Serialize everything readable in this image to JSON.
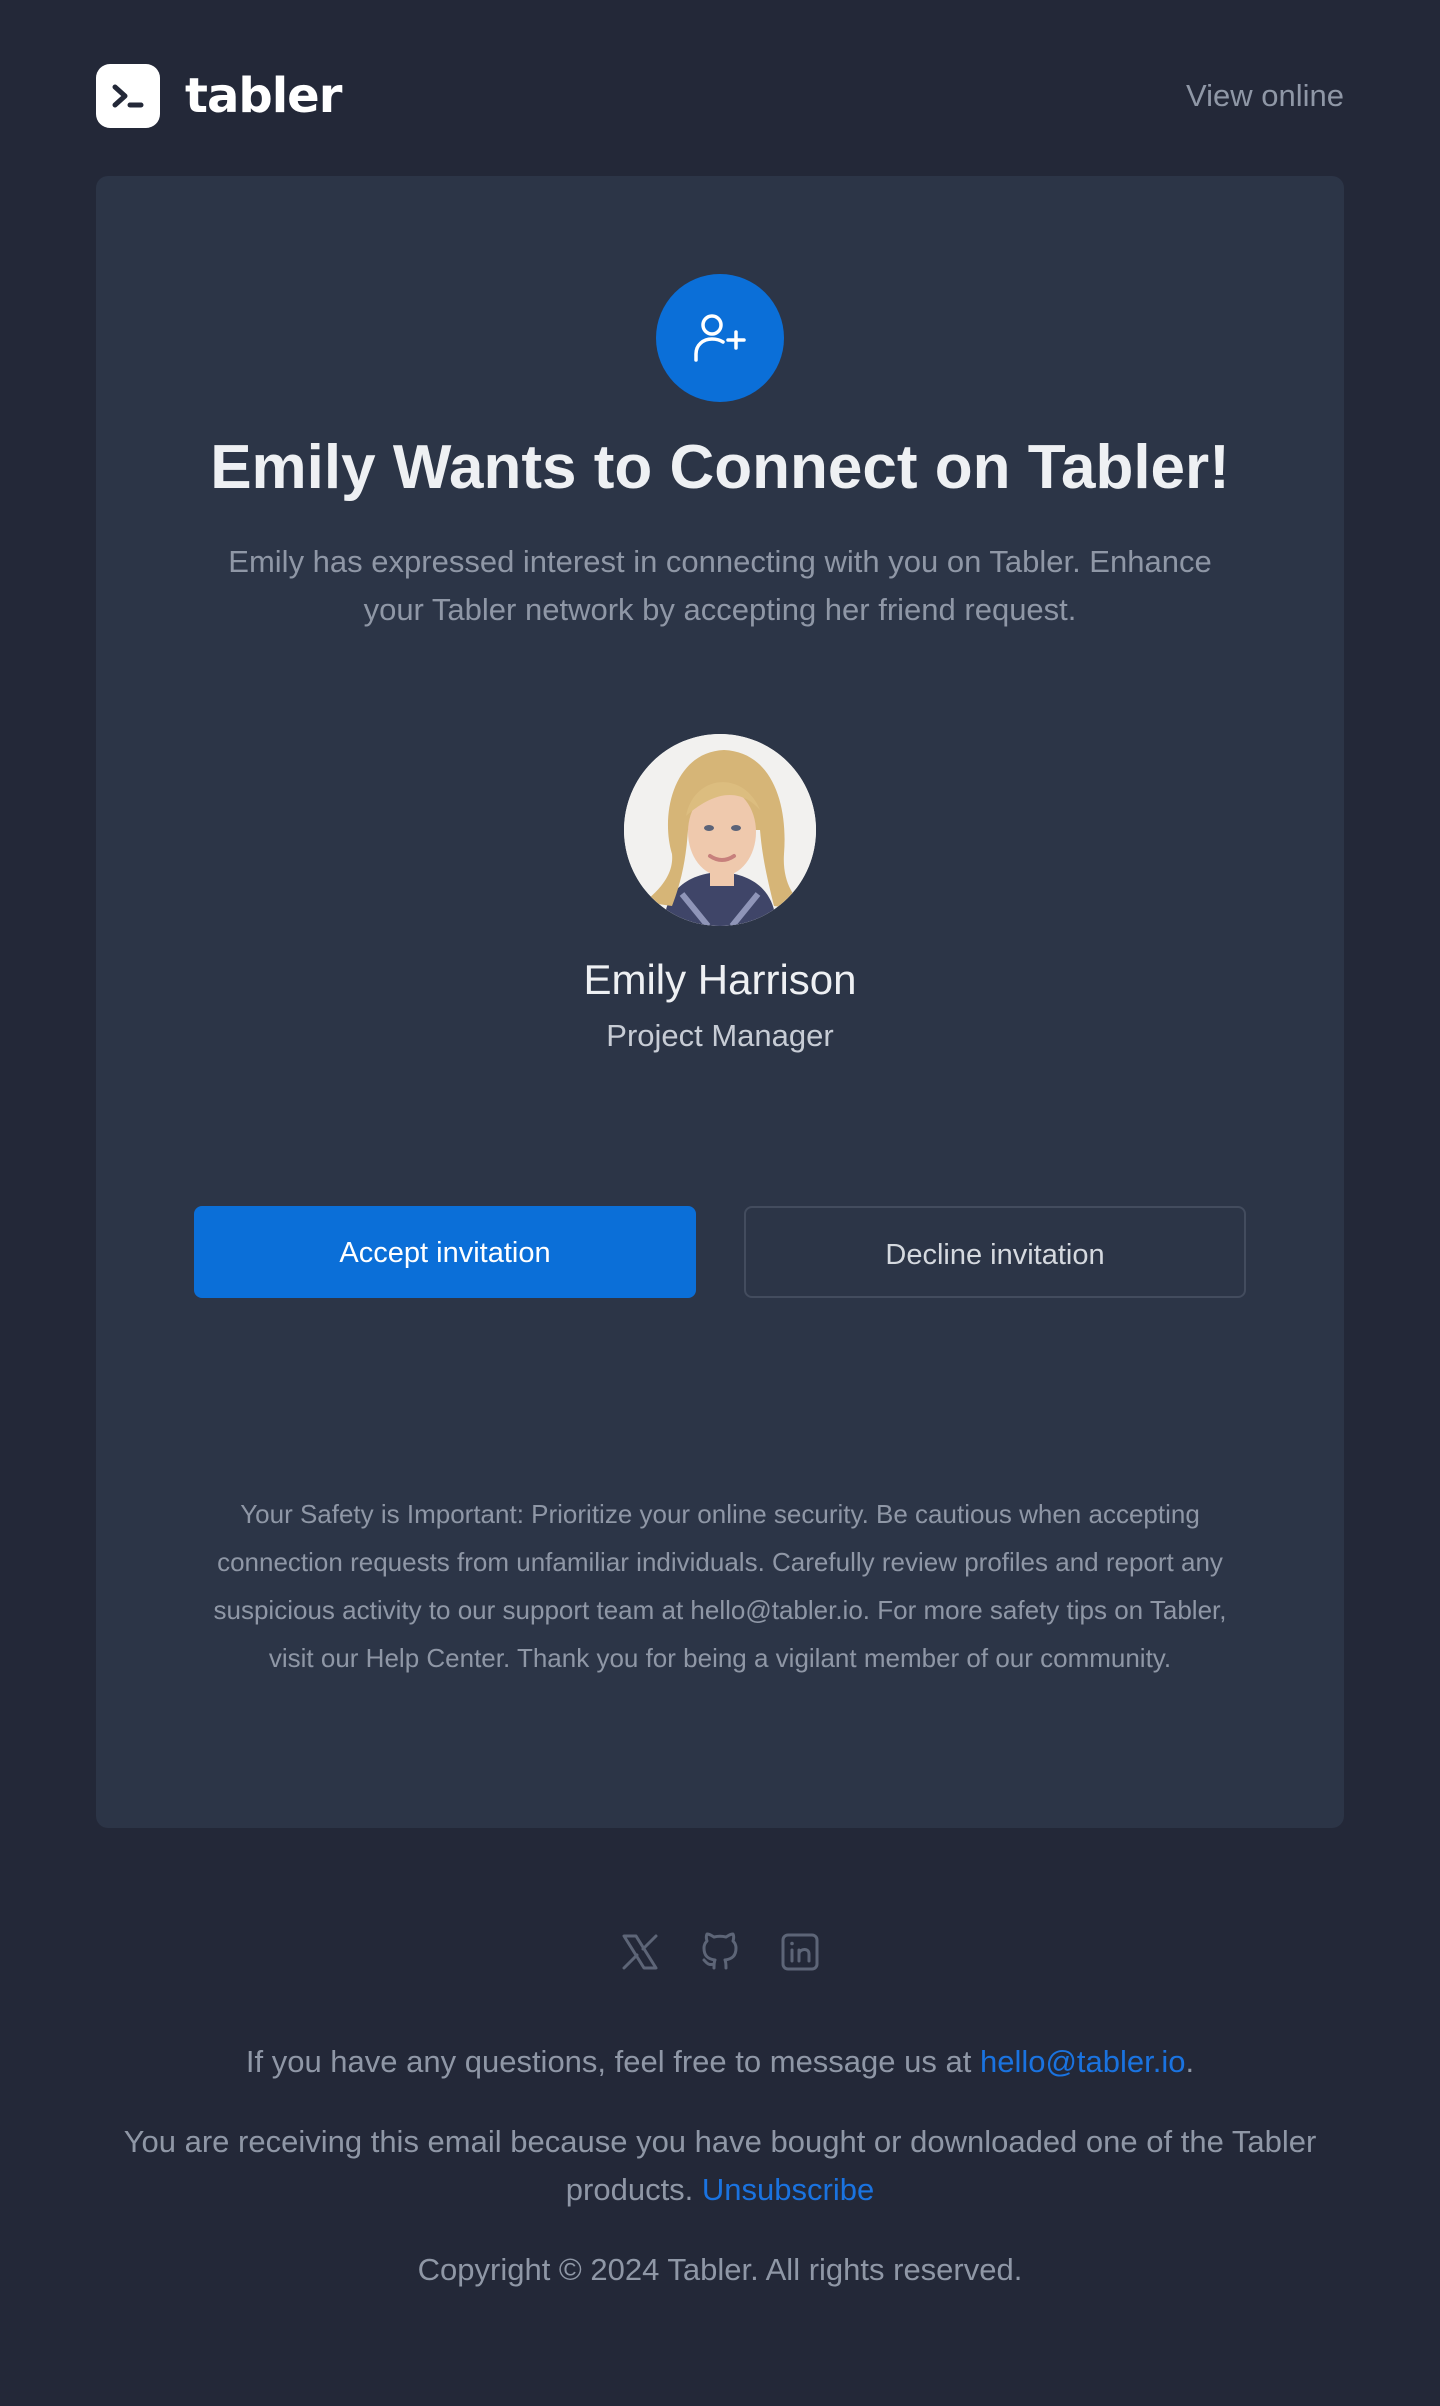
{
  "header": {
    "brand": "tabler",
    "view_online": "View online"
  },
  "card": {
    "title": "Emily Wants to Connect on Tabler!",
    "intro": "Emily has expressed interest in connecting with you on Tabler. Enhance your Tabler network by accepting her friend request.",
    "person": {
      "name": "Emily Harrison",
      "role": "Project Manager"
    },
    "accept_label": "Accept invitation",
    "decline_label": "Decline invitation",
    "safety_note": "Your Safety is Important: Prioritize your online security. Be cautious when accepting connection requests from unfamiliar individuals. Carefully review profiles and report any suspicious activity to our support team at hello@tabler.io. For more safety tips on Tabler, visit our Help Center. Thank you for being a vigilant member of our community."
  },
  "social": {
    "icons": [
      "x-icon",
      "github-icon",
      "linkedin-icon"
    ]
  },
  "footer": {
    "questions_text": "If you have any questions, feel free to message us at ",
    "contact_email": "hello@tabler.io",
    "questions_end": ".",
    "receiving_text": "You are receiving this email because you have bought or downloaded one of the Tabler products. ",
    "unsubscribe_label": "Unsubscribe",
    "copyright": "Copyright © 2024 Tabler. All rights reserved."
  },
  "colors": {
    "background": "#232838",
    "card": "#2c3547",
    "accent": "#0b6fd8",
    "link": "#1a73e0",
    "muted_text": "#8f97a6",
    "heading_text": "#eef0f3"
  }
}
